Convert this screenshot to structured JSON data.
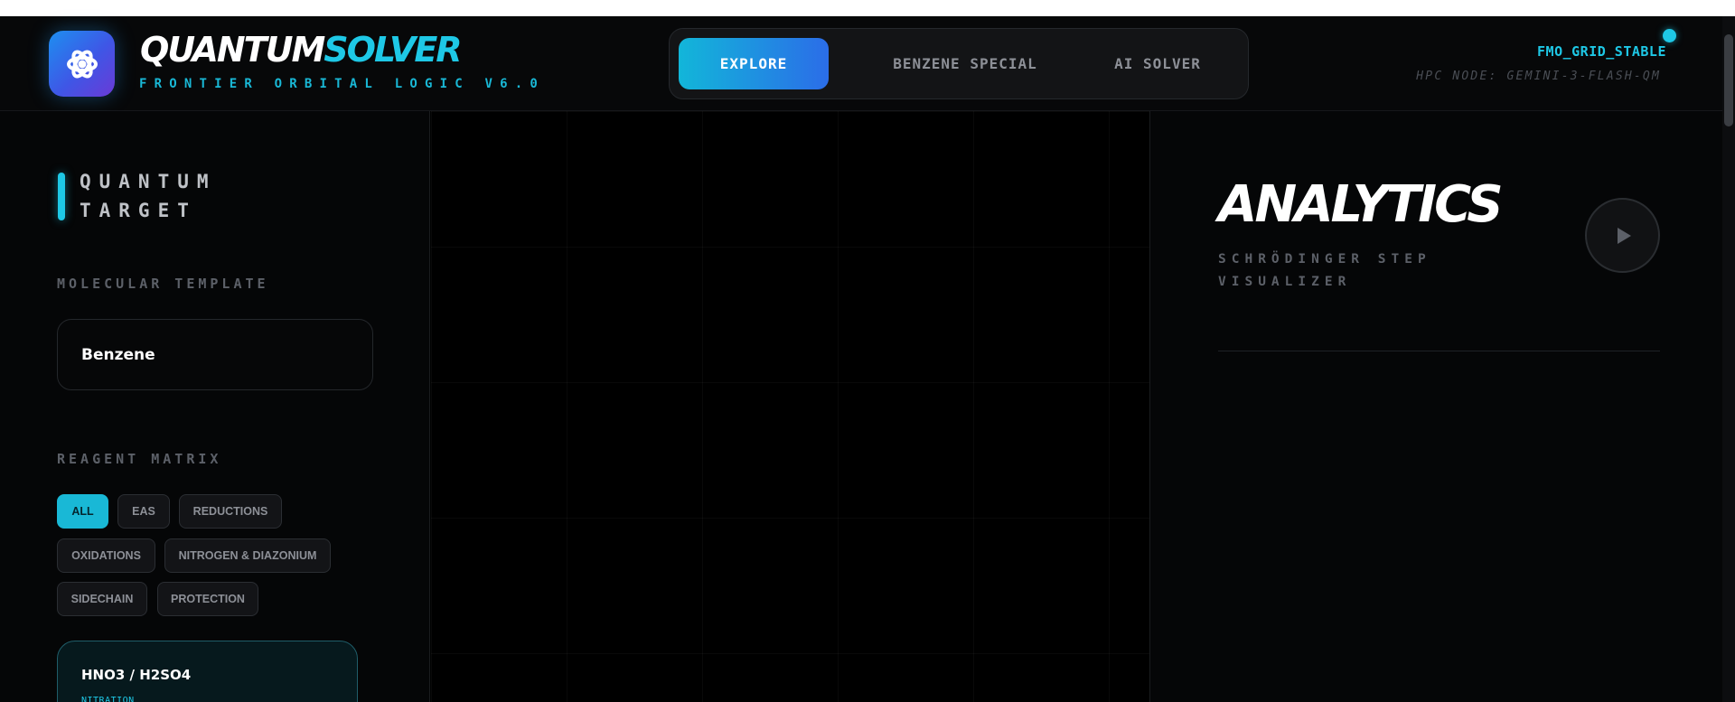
{
  "header": {
    "brand_part1": "QUANTUM",
    "brand_part2": "SOLVER",
    "subtitle": "FRONTIER ORBITAL LOGIC V6.0",
    "nav": [
      {
        "label": "EXPLORE",
        "active": true
      },
      {
        "label": "BENZENE SPECIAL",
        "active": false
      },
      {
        "label": "AI SOLVER",
        "active": false
      }
    ],
    "status": "FMO_GRID_STABLE",
    "hpc_node": "HPC NODE: GEMINI-3-FLASH-QM"
  },
  "sidebar": {
    "title": "QUANTUM TARGET",
    "template_label": "MOLECULAR TEMPLATE",
    "template_value": "Benzene",
    "reagent_label": "REAGENT MATRIX",
    "filters": [
      {
        "label": "ALL",
        "active": true
      },
      {
        "label": "EAS",
        "active": false
      },
      {
        "label": "REDUCTIONS",
        "active": false
      },
      {
        "label": "OXIDATIONS",
        "active": false
      },
      {
        "label": "NITROGEN & DIAZONIUM",
        "active": false
      },
      {
        "label": "SIDECHAIN",
        "active": false
      },
      {
        "label": "PROTECTION",
        "active": false
      }
    ],
    "reagents": [
      {
        "name": "HNO3 / H2SO4",
        "type": "NITRATION"
      }
    ]
  },
  "analytics": {
    "title": "ANALYTICS",
    "subtitle": "SCHRÖDINGER STEP VISUALIZER"
  },
  "colors": {
    "accent": "#1ec8e6",
    "nav_gradient_start": "#12b6d9",
    "nav_gradient_end": "#2b6de8",
    "logo_gradient_start": "#1d8ff0",
    "logo_gradient_end": "#6a3ad6",
    "background": "#000000"
  },
  "icons": {
    "logo": "atom-icon",
    "play": "play-icon",
    "status": "status-dot"
  }
}
